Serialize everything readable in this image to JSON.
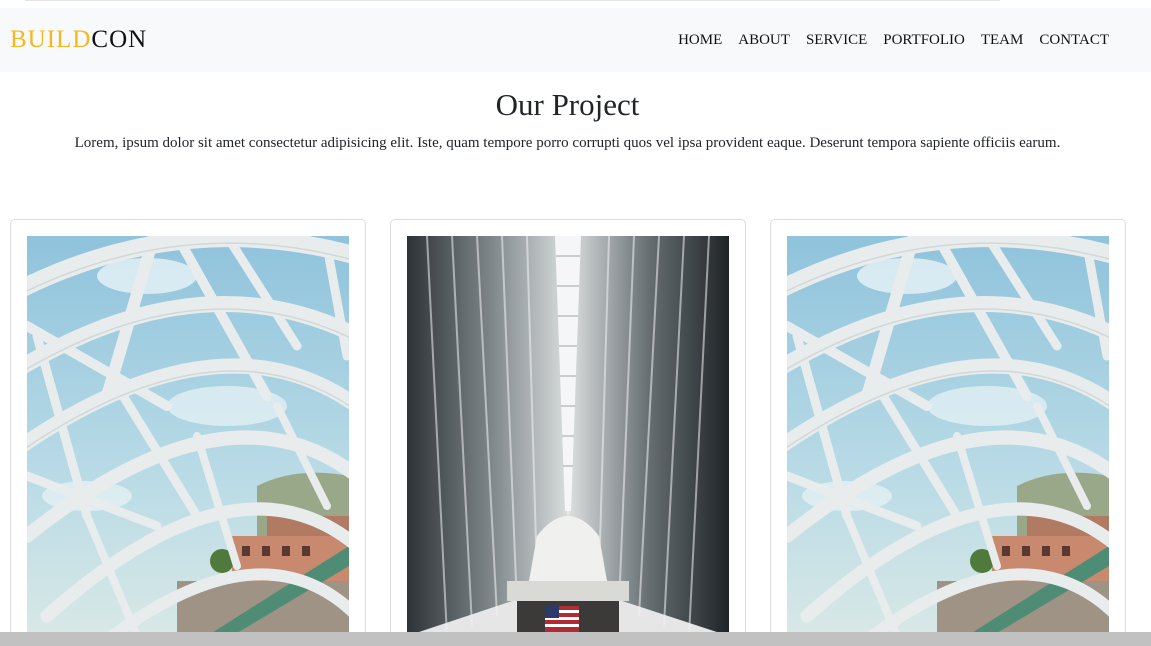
{
  "brand": {
    "part1": "BUILD",
    "part2": "CON"
  },
  "nav": {
    "items": [
      {
        "label": "HOME"
      },
      {
        "label": "ABOUT"
      },
      {
        "label": "SERVICE"
      },
      {
        "label": "PORTFOLIO"
      },
      {
        "label": "TEAM"
      },
      {
        "label": "CONTACT"
      }
    ]
  },
  "section": {
    "title": "Our Project",
    "subtitle": "Lorem, ipsum dolor sit amet consectetur adipisicing elit. Iste, quam tempore porro corrupti quos vel ipsa provident eaque. Deserunt tempora sapiente officiis earum."
  },
  "projects": [
    {
      "image": "bridge-arch-photo"
    },
    {
      "image": "oculus-interior-photo"
    },
    {
      "image": "bridge-arch-photo"
    }
  ],
  "colors": {
    "brand_accent": "#f5b81f",
    "navbar_bg": "#f8f9fa"
  }
}
